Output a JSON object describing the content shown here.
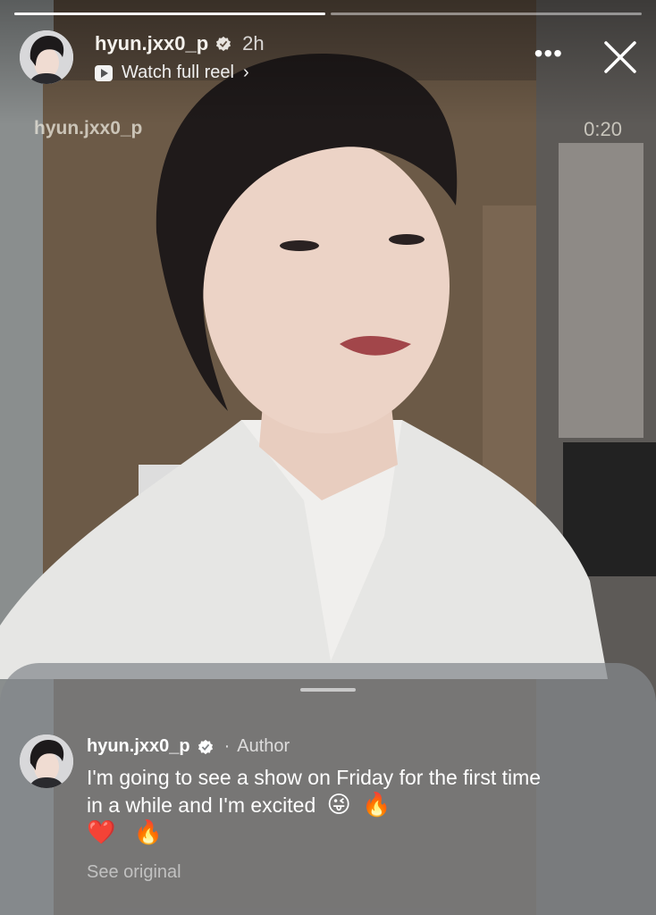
{
  "story": {
    "username": "hyun.jxx0_p",
    "posted": "2h",
    "watch_label": "Watch full reel",
    "chevron": "›",
    "more": "•••",
    "watermark": "hyun.jxx0_p",
    "duration": "0:20",
    "progress": [
      1.0,
      0.0
    ]
  },
  "comment": {
    "username": "hyun.jxx0_p",
    "separator": "·",
    "role": "Author",
    "text": "I'm going to see a show on Friday for the first time in a while and I'm excited",
    "emojis": [
      "😜",
      "🔥",
      "❤️",
      "🔥"
    ],
    "see_original": "See original"
  },
  "colors": {
    "verified_badge": "#ffffff",
    "sheet": "#84888c"
  }
}
